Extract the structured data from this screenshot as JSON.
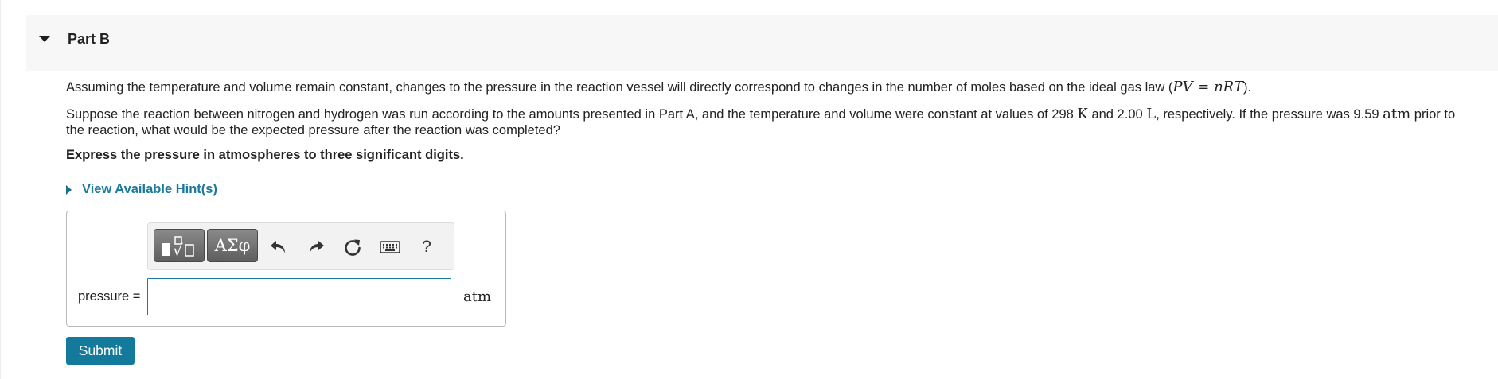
{
  "part": {
    "title": "Part B"
  },
  "question": {
    "para1_text": "Assuming the temperature and volume remain constant, changes to the pressure in the reaction vessel will directly correspond to changes in the number of moles based on the ideal gas law (",
    "para1_math_left": "PV",
    "para1_math_eq": " = ",
    "para1_math_right": "nRT",
    "para1_end": ").",
    "para2_a": "Suppose the reaction between nitrogen and hydrogen was run according to the amounts presented in Part A, and the temperature and volume were constant at values of 298 ",
    "para2_unit_K": "K",
    "para2_b": " and 2.00 ",
    "para2_unit_L": "L",
    "para2_c": ", respectively. If the pressure was 9.59 ",
    "para2_unit_atm": "atm",
    "para2_d": " prior to the reaction, what would be the expected pressure after the reaction was completed?",
    "instruction": "Express the pressure in atmospheres to three significant digits."
  },
  "hint": {
    "label": "View Available Hint(s)"
  },
  "toolbar": {
    "templates_icon": "math-templates-icon",
    "greek_label": "ΑΣφ",
    "undo_icon": "undo-icon",
    "redo_icon": "redo-icon",
    "reset_icon": "reset-icon",
    "keyboard_icon": "keyboard-icon",
    "help_label": "?"
  },
  "answer": {
    "label": "pressure =",
    "value": "",
    "unit": "atm"
  },
  "submit": {
    "label": "Submit"
  },
  "colors": {
    "accent": "#137a9c",
    "link": "#1a7a9a",
    "header_bg": "#f7f7f7"
  }
}
